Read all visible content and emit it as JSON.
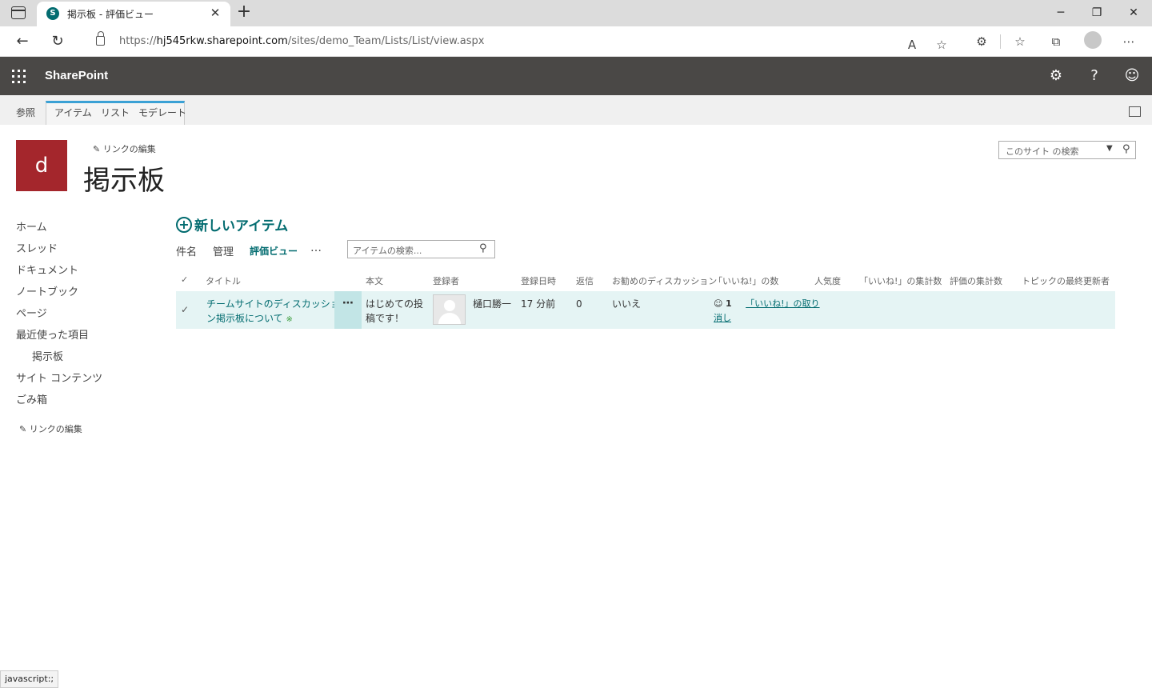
{
  "browser": {
    "tab_title": "掲示板 - 評価ビュー",
    "tab_favicon_letter": "S",
    "tab_close": "✕",
    "new_tab": "+",
    "url_prefix": "https://",
    "url_host": "hj545rkw.sharepoint.com",
    "url_path": "/sites/demo_Team/Lists/List/view.aspx",
    "status_text": "javascript:;"
  },
  "suite": {
    "brand": "SharePoint"
  },
  "ribbon": {
    "tabs": [
      "参照",
      "アイテム",
      "リスト",
      "モデレート"
    ]
  },
  "site": {
    "logo_letter": "d",
    "edit_links": "リンクの編集",
    "title": "掲示板",
    "search_placeholder": "このサイト の検索"
  },
  "quick_launch": {
    "items": [
      "ホーム",
      "スレッド",
      "ドキュメント",
      "ノートブック",
      "ページ",
      "最近使った項目",
      "掲示板",
      "サイト コンテンツ",
      "ごみ箱"
    ],
    "edit_links": "リンクの編集"
  },
  "list": {
    "new_item": "新しいアイテム",
    "views": [
      "件名",
      "管理",
      "評価ビュー"
    ],
    "selected_view": "評価ビュー",
    "more": "…",
    "search_placeholder": "アイテムの検索...",
    "columns": [
      "タイトル",
      "本文",
      "登録者",
      "登録日時",
      "返信",
      "お勧めのディスカッション",
      "「いいね!」の数",
      "人気度",
      "「いいね!」の集計数",
      "評価の集計数",
      "トピックの最終更新者"
    ],
    "rows": [
      {
        "title_line1": "チームサイトのディスカッショ",
        "title_line2": "ン掲示板について",
        "new_badge": "※",
        "body_line1": "はじめての投",
        "body_line2": "稿です！",
        "author": "樋口勝一",
        "created": "17 分前",
        "replies": "0",
        "featured": "いいえ",
        "like_count": "1",
        "like_action_line1": "「いいね!」の取り",
        "like_action_line2": "消し"
      }
    ]
  }
}
